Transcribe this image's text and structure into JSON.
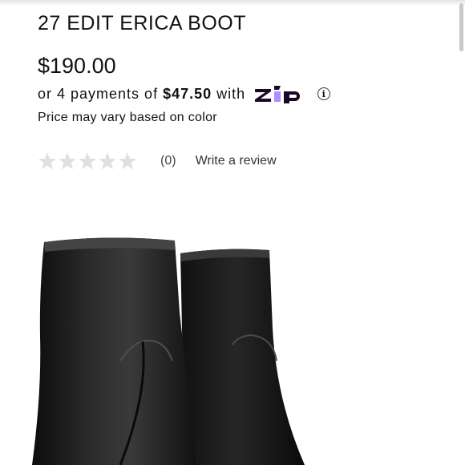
{
  "product": {
    "title": "27 EDIT ERICA BOOT",
    "price": "$190.00",
    "installments": {
      "prefix": "or 4 payments of",
      "amount": "$47.50",
      "suffix": "with",
      "provider": "zip"
    },
    "price_note": "Price may vary based on color"
  },
  "rating": {
    "stars": 0,
    "max_stars": 5,
    "review_count": "(0)",
    "write_review": "Write a review"
  },
  "colors": {
    "text": "#111111",
    "star_empty": "#e0e0e0",
    "zip_purple": "#aa8fff",
    "zip_dark": "#1a0826"
  },
  "icons": {
    "info": "info-icon",
    "star": "star-icon"
  }
}
